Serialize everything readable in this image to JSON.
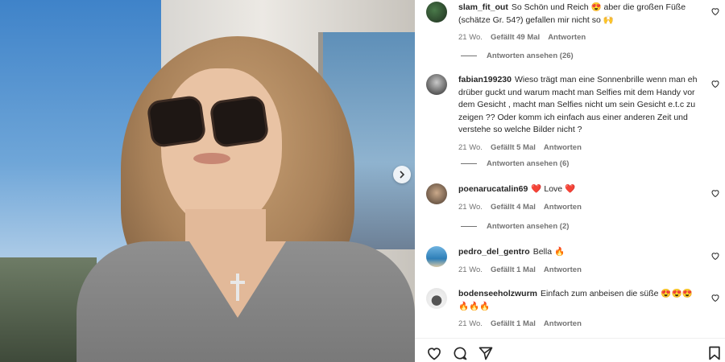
{
  "comments": [
    {
      "username": "slam_fit_out",
      "text": "So Schön und Reich 😍 aber die großen Füße (schätze Gr. 54?) gefallen mir nicht so 🙌",
      "time": "21 Wo.",
      "likes": "Gefällt 49 Mal",
      "reply_label": "Antworten",
      "view_replies": "Antworten ansehen (26)"
    },
    {
      "username": "fabian199230",
      "text": "Wieso trägt man eine Sonnenbrille wenn man eh drüber guckt und warum macht man Selfies mit dem Handy vor dem Gesicht , macht man Selfies nicht um sein Gesicht e.t.c zu zeigen ?? Oder komm ich einfach aus einer anderen Zeit und verstehe so welche Bilder nicht ?",
      "time": "21 Wo.",
      "likes": "Gefällt 5 Mal",
      "reply_label": "Antworten",
      "view_replies": "Antworten ansehen (6)"
    },
    {
      "username": "poenarucatalin69",
      "text": "❤️ Love ❤️",
      "time": "21 Wo.",
      "likes": "Gefällt 4 Mal",
      "reply_label": "Antworten",
      "view_replies": "Antworten ansehen (2)"
    },
    {
      "username": "pedro_del_gentro",
      "text": "Bella 🔥",
      "time": "21 Wo.",
      "likes": "Gefällt 1 Mal",
      "reply_label": "Antworten",
      "view_replies": ""
    },
    {
      "username": "bodenseeholzwurm",
      "text": "Einfach zum anbeisen die süße 😍😍😍 🔥🔥🔥",
      "time": "21 Wo.",
      "likes": "Gefällt 1 Mal",
      "reply_label": "Antworten",
      "view_replies": ""
    }
  ],
  "icons": {
    "like": "heart-icon",
    "comment": "comment-icon",
    "share": "share-icon",
    "save": "bookmark-icon",
    "next": "chevron-right-icon"
  },
  "colors": {
    "text": "#262626",
    "meta": "#737373",
    "divider": "#efefef"
  }
}
